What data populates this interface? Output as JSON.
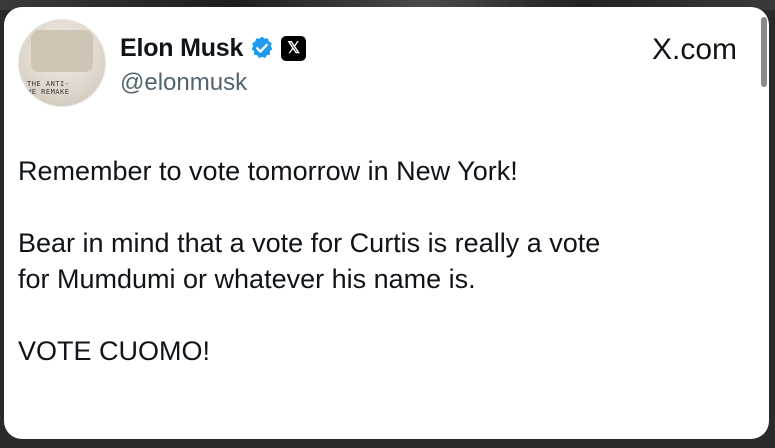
{
  "post": {
    "author": {
      "display_name": "Elon Musk",
      "handle": "@elonmusk",
      "verified_icon": "verified-check-icon",
      "affiliation_icon": "x-logo-icon",
      "avatar_text": "THE ANTI-\nWE REMAKE"
    },
    "site_label": "X.com",
    "lines": [
      "Remember to vote tomorrow in New York!",
      "Bear in mind that a vote for Curtis is really a vote",
      "for Mumdumi or whatever his name is.",
      "VOTE CUOMO!"
    ],
    "colors": {
      "text": "#0f1419",
      "secondary": "#536471",
      "verified": "#1d9bf0"
    }
  }
}
